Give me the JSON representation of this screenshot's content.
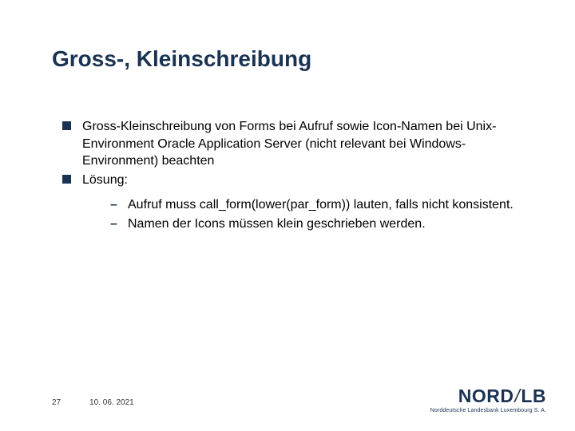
{
  "title": "Gross-, Kleinschreibung",
  "bullets": {
    "l1": [
      "Gross-Kleinschreibung von Forms bei Aufruf sowie Icon-Namen bei Unix-Environment Oracle Application Server (nicht relevant bei Windows-Environment) beachten",
      "Lösung:"
    ],
    "l2": [
      "Aufruf muss call_form(lower(par_form)) lauten, falls nicht konsistent.",
      "Namen der Icons müssen klein geschrieben werden."
    ]
  },
  "footer": {
    "page": "27",
    "date": "10. 06. 2021"
  },
  "logo": {
    "brand_left": "NORD",
    "brand_right": "LB",
    "sub": "Norddeutsche Landesbank Luxembourg S. A."
  }
}
